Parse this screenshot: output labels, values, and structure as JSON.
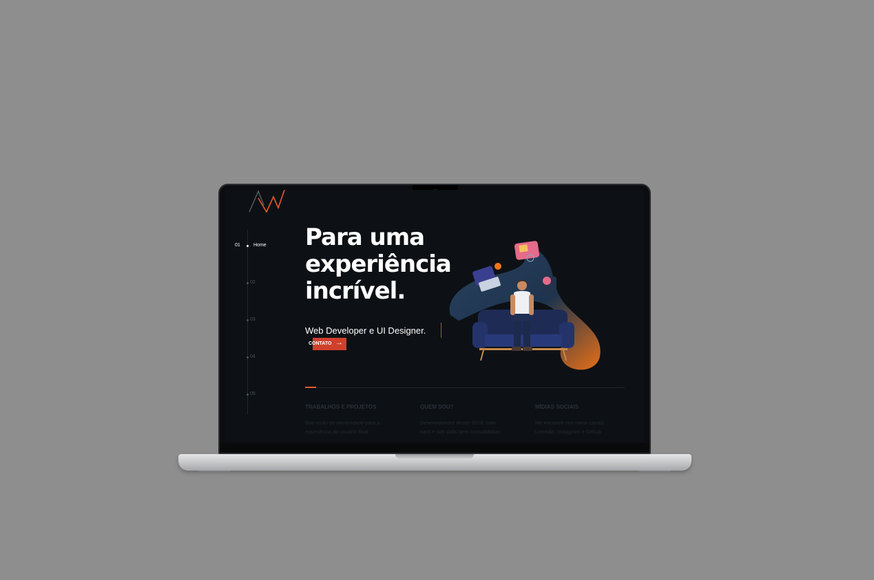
{
  "brand": {
    "logo": "MW monogram",
    "accent_color": "#e8592a",
    "button_color": "#d0402b",
    "background_color": "#0d1115"
  },
  "sidebar": {
    "items": [
      {
        "num": "01",
        "label": "Home",
        "active": true
      },
      {
        "num": "02",
        "label": ""
      },
      {
        "num": "03",
        "label": ""
      },
      {
        "num": "04",
        "label": ""
      },
      {
        "num": "05",
        "label": ""
      }
    ]
  },
  "hero": {
    "title_lines": [
      "Para uma",
      "experiência",
      "incrível."
    ],
    "subtitle": "Web Developer e UI Designer.",
    "cta_label": "CONTATO",
    "cta_icon": "arrow-right-icon"
  },
  "sections": [
    {
      "title": "TRABALHOS E PROJETOS",
      "lines": [
        "Boa visão de intuitividade para a",
        "experiência do usuário final"
      ]
    },
    {
      "title": "QUEM SOU?",
      "lines": [
        "Desenvolvedor desde 2018, com",
        "hard e soft skills bem consolidadas"
      ]
    },
    {
      "title": "MÍDIAS SOCIAIS",
      "lines": [
        "Me encontre nos meus canais",
        "Linkedin, Instagram e Github"
      ]
    }
  ]
}
